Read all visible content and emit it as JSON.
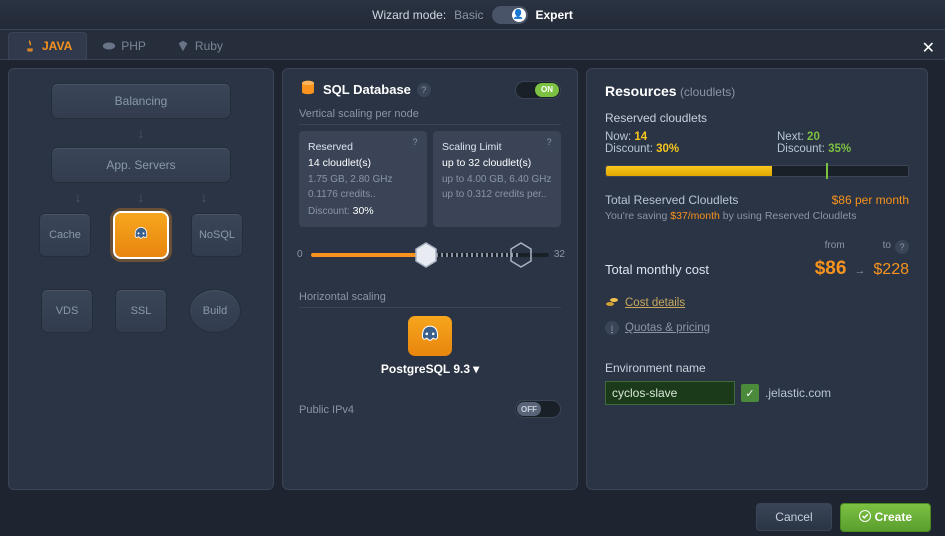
{
  "header": {
    "label": "Wizard mode:",
    "basic": "Basic",
    "expert": "Expert"
  },
  "tabs": {
    "java": "JAVA",
    "php": "PHP",
    "ruby": "Ruby"
  },
  "left": {
    "balancing": "Balancing",
    "appservers": "App. Servers",
    "cache": "Cache",
    "nosql": "NoSQL",
    "vds": "VDS",
    "ssl": "SSL",
    "build": "Build"
  },
  "mid": {
    "title": "SQL Database",
    "on": "ON",
    "vscale": "Vertical scaling per node",
    "reserved": {
      "title": "Reserved",
      "count": "14 cloudlet(s)",
      "spec": "1.75 GB, 2.80 GHz",
      "credits": "0.1176 credits..",
      "disc_lbl": "Discount:",
      "disc_val": "30%"
    },
    "limit": {
      "title": "Scaling Limit",
      "count": "up to 32 cloudlet(s)",
      "spec": "up to 4.00 GB, 6.40 GHz",
      "credits": "up to 0.312 credits per.."
    },
    "slider_min": "0",
    "slider_max": "32",
    "hscale": "Horizontal scaling",
    "db": "PostgreSQL 9.3",
    "pubip": "Public IPv4",
    "off": "OFF"
  },
  "right": {
    "title": "Resources",
    "title_sub": "(cloudlets)",
    "rc": "Reserved cloudlets",
    "now_lbl": "Now:",
    "now_val": "14",
    "next_lbl": "Next:",
    "next_val": "20",
    "disc_lbl": "Discount:",
    "disc_now": "30%",
    "disc_next": "35%",
    "trc": "Total Reserved Cloudlets",
    "trc_val": "$86 per month",
    "save1": "You're saving ",
    "save_amt": "$37/month",
    "save2": " by using Reserved Cloudlets",
    "from_lbl": "from",
    "to_lbl": "to",
    "tmc": "Total monthly cost",
    "price_from": "$86",
    "price_to": "$228",
    "link1": "Cost details",
    "link2": "Quotas & pricing",
    "env_lbl": "Environment name",
    "env_val": "cyclos-slave",
    "env_domain": ".jelastic.com"
  },
  "footer": {
    "cancel": "Cancel",
    "create": "Create"
  }
}
